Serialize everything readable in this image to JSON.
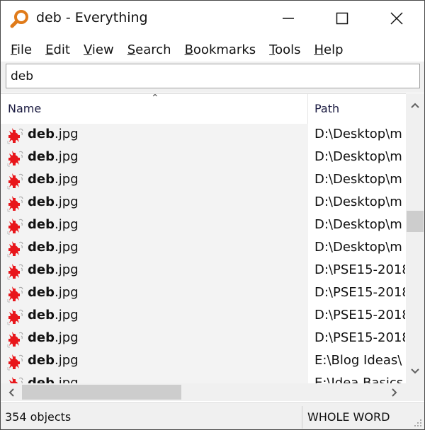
{
  "window": {
    "title": "deb - Everything",
    "controls": {
      "minimize": "minimize",
      "maximize": "maximize",
      "close": "close"
    }
  },
  "menu": {
    "items": [
      {
        "label": "File",
        "accel": "F",
        "rest": "ile"
      },
      {
        "label": "Edit",
        "accel": "E",
        "rest": "dit"
      },
      {
        "label": "View",
        "accel": "V",
        "rest": "iew"
      },
      {
        "label": "Search",
        "accel": "S",
        "rest": "earch"
      },
      {
        "label": "Bookmarks",
        "accel": "B",
        "rest": "ookmarks"
      },
      {
        "label": "Tools",
        "accel": "T",
        "rest": "ools"
      },
      {
        "label": "Help",
        "accel": "H",
        "rest": "elp"
      }
    ]
  },
  "search": {
    "value": "deb"
  },
  "columns": {
    "name": "Name",
    "path": "Path",
    "sort": "ascending"
  },
  "results": [
    {
      "match": "deb",
      "rest": ".jpg",
      "path": "D:\\Desktop\\m",
      "icon": "image-file-icon"
    },
    {
      "match": "deb",
      "rest": ".jpg",
      "path": "D:\\Desktop\\m",
      "icon": "image-file-icon"
    },
    {
      "match": "deb",
      "rest": ".jpg",
      "path": "D:\\Desktop\\m",
      "icon": "image-file-icon"
    },
    {
      "match": "deb",
      "rest": ".jpg",
      "path": "D:\\Desktop\\m",
      "icon": "image-file-icon"
    },
    {
      "match": "deb",
      "rest": ".jpg",
      "path": "D:\\Desktop\\m",
      "icon": "image-file-icon"
    },
    {
      "match": "deb",
      "rest": ".jpg",
      "path": "D:\\Desktop\\m",
      "icon": "image-file-icon"
    },
    {
      "match": "deb",
      "rest": ".jpg",
      "path": "D:\\PSE15-2018",
      "icon": "image-file-icon"
    },
    {
      "match": "deb",
      "rest": ".jpg",
      "path": "D:\\PSE15-2018",
      "icon": "image-file-icon"
    },
    {
      "match": "deb",
      "rest": ".jpg",
      "path": "D:\\PSE15-2018",
      "icon": "image-file-icon"
    },
    {
      "match": "deb",
      "rest": ".jpg",
      "path": "D:\\PSE15-2018",
      "icon": "image-file-icon"
    },
    {
      "match": "deb",
      "rest": ".jpg",
      "path": "E:\\Blog Ideas\\",
      "icon": "image-file-icon"
    },
    {
      "match": "deb",
      "rest": ".jpg",
      "path": "E:\\Idea Basics",
      "icon": "image-file-icon"
    }
  ],
  "scroll": {
    "vertical_position": 0.4,
    "horizontal_visible_fraction": 0.42
  },
  "status": {
    "count": "354 objects",
    "mode": "WHOLE WORD"
  },
  "colors": {
    "accent": "#e07b1a",
    "icon_red": "#e8161b"
  }
}
